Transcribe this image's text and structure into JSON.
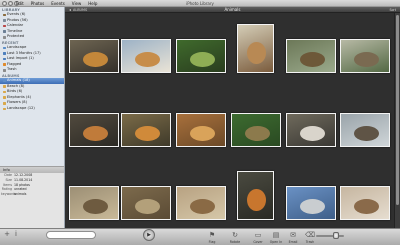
{
  "window": {
    "title": "iPhoto Library",
    "menu": [
      "Edit",
      "Photos",
      "Events",
      "View",
      "Help"
    ]
  },
  "sidebar": {
    "sections": [
      {
        "heading": "LIBRARY",
        "items": [
          {
            "label": "Events (6)",
            "icon": "events-icon",
            "color": "#8a6b3d"
          },
          {
            "label": "Photos (56)",
            "icon": "photos-icon",
            "color": "#7d8b9a"
          },
          {
            "label": "Calendar",
            "icon": "calendar-icon",
            "color": "#b94848"
          },
          {
            "label": "Timeline",
            "icon": "timeline-icon",
            "color": "#6c7f95"
          },
          {
            "label": "Protected",
            "icon": "lock-icon",
            "color": "#8d8d8d"
          }
        ]
      },
      {
        "heading": "RECENT",
        "items": [
          {
            "label": "Landscape",
            "icon": "album-icon",
            "color": "#5d8fc8"
          },
          {
            "label": "Last 3 Months (17)",
            "icon": "calendar-icon",
            "color": "#4d7fbd"
          },
          {
            "label": "Last Import (1)",
            "icon": "import-icon",
            "color": "#4d7fbd"
          },
          {
            "label": "Flagged",
            "icon": "flag-icon",
            "color": "#e08a2b"
          },
          {
            "label": "Trash",
            "icon": "trash-icon",
            "color": "#8a8a8a"
          }
        ]
      },
      {
        "heading": "ALBUMS",
        "items": [
          {
            "label": "Animals (18)",
            "icon": "album-icon",
            "color": "#5d8fc8",
            "selected": true
          },
          {
            "label": "Beach (8)",
            "icon": "album-icon",
            "color": "#d9a84a"
          },
          {
            "label": "Birds (6)",
            "icon": "album-icon",
            "color": "#d9a84a"
          },
          {
            "label": "Elephants (4)",
            "icon": "album-icon",
            "color": "#d9a84a"
          },
          {
            "label": "Flowers (8)",
            "icon": "album-icon",
            "color": "#d9a84a"
          },
          {
            "label": "Landscape (12)",
            "icon": "album-icon",
            "color": "#d9a84a"
          }
        ]
      }
    ]
  },
  "info": {
    "heading": "Info",
    "rows": [
      {
        "label": "Date",
        "value": "12.12.2008"
      },
      {
        "label": "Size",
        "value": "11.08.2014"
      },
      {
        "label": "Items",
        "value": "18 photos"
      },
      {
        "label": "Rating",
        "value": "unrated"
      },
      {
        "label": "keywords",
        "value": "animals"
      }
    ]
  },
  "pathbar": {
    "back": "◂",
    "crumb": "ALBUMS",
    "title": "Animals",
    "sort": "Sort"
  },
  "photos": [
    {
      "colors": [
        "#6e6552",
        "#c3873a",
        "#34302a"
      ]
    },
    {
      "colors": [
        "#9db2c6",
        "#c78d4a",
        "#e9e3d6"
      ]
    },
    {
      "colors": [
        "#3f6a2c",
        "#8fae55",
        "#2a3d1f"
      ]
    },
    {
      "colors": [
        "#d4cdb7",
        "#b88954",
        "#7b5c3d"
      ]
    },
    {
      "colors": [
        "#6c7858",
        "#6d5839",
        "#9aa98b"
      ]
    },
    {
      "colors": [
        "#b7b9a5",
        "#7a6a51",
        "#536944"
      ]
    },
    {
      "colors": [
        "#514a3e",
        "#c07b3a",
        "#2c2a25"
      ]
    },
    {
      "colors": [
        "#7b6b48",
        "#d08a3a",
        "#3f3a2a"
      ]
    },
    {
      "colors": [
        "#a8703c",
        "#d9a35a",
        "#6c4a28"
      ]
    },
    {
      "colors": [
        "#3d6b30",
        "#8c7a4c",
        "#2a4a22"
      ]
    },
    {
      "colors": [
        "#6f6a5c",
        "#d9d4cb",
        "#3a3834"
      ]
    },
    {
      "colors": [
        "#9aa4aa",
        "#5f5446",
        "#cfd5d8"
      ]
    },
    {
      "colors": [
        "#9c8f75",
        "#6e5b40",
        "#c9b998"
      ]
    },
    {
      "colors": [
        "#7c6a4c",
        "#b3a07a",
        "#5b4b35"
      ]
    },
    {
      "colors": [
        "#b8a282",
        "#8a6a45",
        "#d5c7a8"
      ]
    },
    {
      "colors": [
        "#4a4a40",
        "#c8762e",
        "#2a2a24"
      ]
    },
    {
      "colors": [
        "#6a91c4",
        "#c9cdd0",
        "#3f5f89"
      ]
    },
    {
      "colors": [
        "#c6b6a0",
        "#8a6a4a",
        "#e6ddd0"
      ]
    }
  ],
  "toolbar": {
    "search_placeholder": "",
    "play": "▶",
    "buttons": [
      {
        "label": "Flag",
        "glyph": "⚑"
      },
      {
        "label": "Rotate",
        "glyph": "↻"
      },
      {
        "label": "Cover",
        "glyph": "▭"
      },
      {
        "label": "Open In",
        "glyph": "▤"
      },
      {
        "label": "Email",
        "glyph": "✉"
      },
      {
        "label": "Trash",
        "glyph": "⌫"
      }
    ],
    "add_glyph": "+",
    "info_glyph": "i"
  },
  "accent": "#3d6db5"
}
